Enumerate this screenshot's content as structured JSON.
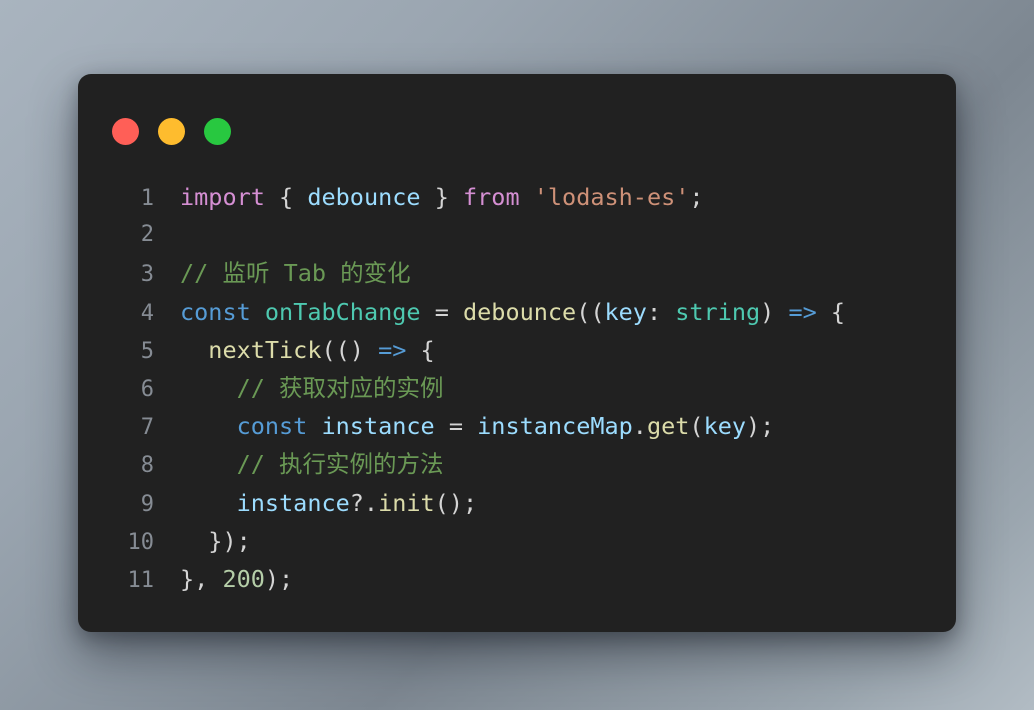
{
  "window": {
    "background_gradient_from": "#a9b4bf",
    "background_gradient_to": "#b2bcc4",
    "panel_background": "#212121",
    "traffic_lights": [
      {
        "name": "close",
        "color": "#ff5f57"
      },
      {
        "name": "minimize",
        "color": "#febc2e"
      },
      {
        "name": "maximize",
        "color": "#28c840"
      }
    ]
  },
  "theme": {
    "keyword": "#569cd6",
    "import": "#d58fd3",
    "variable": "#9cdcfe",
    "function": "#dcdcaa",
    "definition": "#4ec9b0",
    "string": "#ce9178",
    "number": "#b5cea8",
    "comment": "#6a9955",
    "punctuation": "#d4d4d4",
    "line_number": "#868c94"
  },
  "editor": {
    "language": "typescript",
    "line_numbers": [
      "1",
      "2",
      "3",
      "4",
      "5",
      "6",
      "7",
      "8",
      "9",
      "10",
      "11"
    ],
    "lines": [
      {
        "number": "1",
        "text": "import { debounce } from 'lodash-es';",
        "tokens": [
          {
            "t": "import",
            "c": "import"
          },
          {
            "t": " ",
            "c": "plain"
          },
          {
            "t": "{",
            "c": "pun"
          },
          {
            "t": " ",
            "c": "plain"
          },
          {
            "t": "debounce",
            "c": "var"
          },
          {
            "t": " ",
            "c": "plain"
          },
          {
            "t": "}",
            "c": "pun"
          },
          {
            "t": " ",
            "c": "plain"
          },
          {
            "t": "from",
            "c": "import"
          },
          {
            "t": " ",
            "c": "plain"
          },
          {
            "t": "'lodash-es'",
            "c": "str"
          },
          {
            "t": ";",
            "c": "pun"
          }
        ]
      },
      {
        "number": "2",
        "text": "",
        "tokens": []
      },
      {
        "number": "3",
        "text": "// 监听 Tab 的变化",
        "tokens": [
          {
            "t": "// 监听 Tab 的变化",
            "c": "cmt"
          }
        ]
      },
      {
        "number": "4",
        "text": "const onTabChange = debounce((key: string) => {",
        "tokens": [
          {
            "t": "const",
            "c": "kw"
          },
          {
            "t": " ",
            "c": "plain"
          },
          {
            "t": "onTabChange",
            "c": "def"
          },
          {
            "t": " ",
            "c": "plain"
          },
          {
            "t": "=",
            "c": "pun"
          },
          {
            "t": " ",
            "c": "plain"
          },
          {
            "t": "debounce",
            "c": "fn"
          },
          {
            "t": "((",
            "c": "pun"
          },
          {
            "t": "key",
            "c": "var"
          },
          {
            "t": ":",
            "c": "pun"
          },
          {
            "t": " ",
            "c": "plain"
          },
          {
            "t": "string",
            "c": "def"
          },
          {
            "t": ")",
            "c": "pun"
          },
          {
            "t": " ",
            "c": "plain"
          },
          {
            "t": "=>",
            "c": "op"
          },
          {
            "t": " ",
            "c": "plain"
          },
          {
            "t": "{",
            "c": "pun"
          }
        ]
      },
      {
        "number": "5",
        "text": "  nextTick(() => {",
        "tokens": [
          {
            "t": "  ",
            "c": "plain"
          },
          {
            "t": "nextTick",
            "c": "fn"
          },
          {
            "t": "(()",
            "c": "pun"
          },
          {
            "t": " ",
            "c": "plain"
          },
          {
            "t": "=>",
            "c": "op"
          },
          {
            "t": " ",
            "c": "plain"
          },
          {
            "t": "{",
            "c": "pun"
          }
        ]
      },
      {
        "number": "6",
        "text": "    // 获取对应的实例",
        "tokens": [
          {
            "t": "    ",
            "c": "plain"
          },
          {
            "t": "// 获取对应的实例",
            "c": "cmt"
          }
        ]
      },
      {
        "number": "7",
        "text": "    const instance = instanceMap.get(key);",
        "tokens": [
          {
            "t": "    ",
            "c": "plain"
          },
          {
            "t": "const",
            "c": "kw"
          },
          {
            "t": " ",
            "c": "plain"
          },
          {
            "t": "instance",
            "c": "var"
          },
          {
            "t": " ",
            "c": "plain"
          },
          {
            "t": "=",
            "c": "pun"
          },
          {
            "t": " ",
            "c": "plain"
          },
          {
            "t": "instanceMap",
            "c": "var"
          },
          {
            "t": ".",
            "c": "pun"
          },
          {
            "t": "get",
            "c": "fn"
          },
          {
            "t": "(",
            "c": "pun"
          },
          {
            "t": "key",
            "c": "var"
          },
          {
            "t": ");",
            "c": "pun"
          }
        ]
      },
      {
        "number": "8",
        "text": "    // 执行实例的方法",
        "tokens": [
          {
            "t": "    ",
            "c": "plain"
          },
          {
            "t": "// 执行实例的方法",
            "c": "cmt"
          }
        ]
      },
      {
        "number": "9",
        "text": "    instance?.init();",
        "tokens": [
          {
            "t": "    ",
            "c": "plain"
          },
          {
            "t": "instance",
            "c": "var"
          },
          {
            "t": "?.",
            "c": "pun"
          },
          {
            "t": "init",
            "c": "fn"
          },
          {
            "t": "();",
            "c": "pun"
          }
        ]
      },
      {
        "number": "10",
        "text": "  });",
        "tokens": [
          {
            "t": "  ",
            "c": "plain"
          },
          {
            "t": "});",
            "c": "pun"
          }
        ]
      },
      {
        "number": "11",
        "text": "}, 200);",
        "tokens": [
          {
            "t": "}, ",
            "c": "pun"
          },
          {
            "t": "200",
            "c": "num"
          },
          {
            "t": ");",
            "c": "pun"
          }
        ]
      }
    ]
  }
}
